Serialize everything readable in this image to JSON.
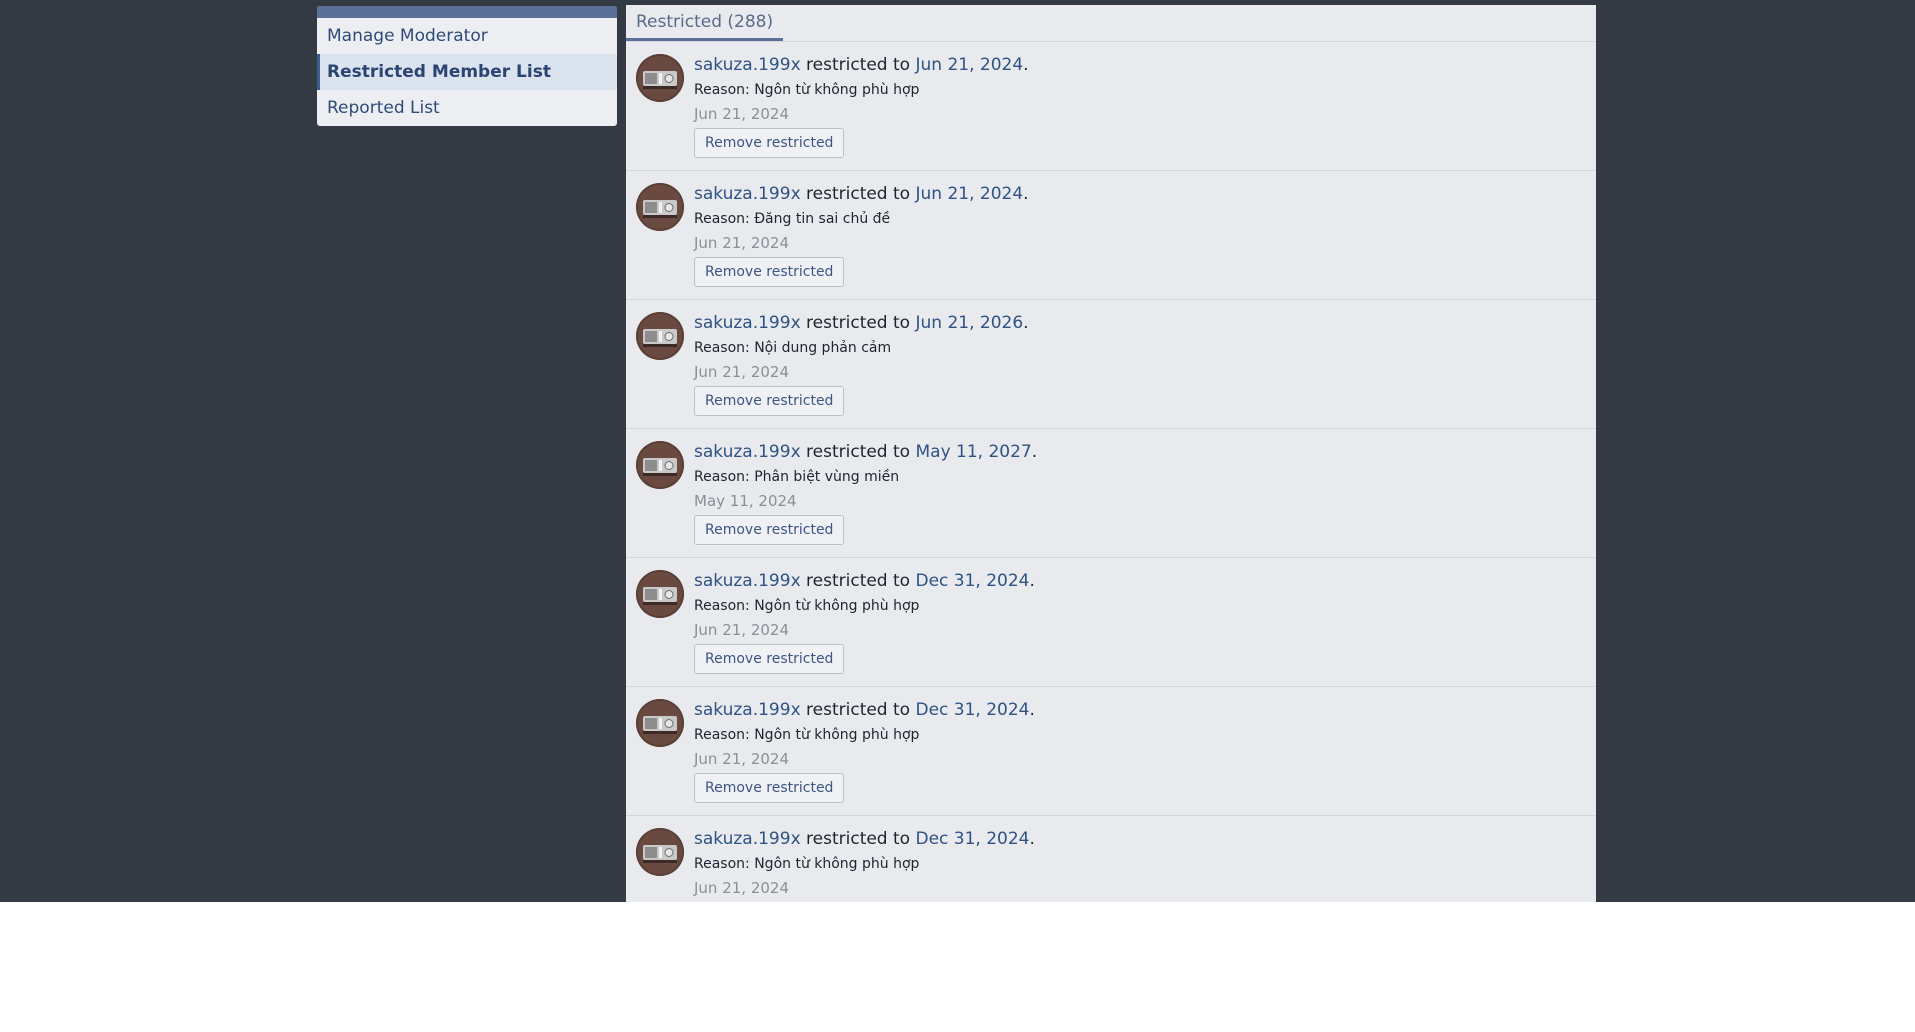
{
  "sidebar": {
    "items": [
      {
        "label": "Manage Moderator",
        "active": false
      },
      {
        "label": "Restricted Member List",
        "active": true
      },
      {
        "label": "Reported List",
        "active": false
      }
    ]
  },
  "main": {
    "tab_label": "Restricted (288)",
    "restricted_word": "restricted to",
    "reason_prefix": "Reason:",
    "button_label": "Remove restricted",
    "rows": [
      {
        "user": "sakuza.199x",
        "until": "Jun 21, 2024",
        "reason": "Ngôn từ không phù hợp",
        "date": "Jun 21, 2024"
      },
      {
        "user": "sakuza.199x",
        "until": "Jun 21, 2024",
        "reason": "Đăng tin sai chủ đề",
        "date": "Jun 21, 2024"
      },
      {
        "user": "sakuza.199x",
        "until": "Jun 21, 2026",
        "reason": "Nội dung phản cảm",
        "date": "Jun 21, 2024"
      },
      {
        "user": "sakuza.199x",
        "until": "May 11, 2027",
        "reason": "Phân biệt vùng miền",
        "date": "May 11, 2024"
      },
      {
        "user": "sakuza.199x",
        "until": "Dec 31, 2024",
        "reason": "Ngôn từ không phù hợp",
        "date": "Jun 21, 2024"
      },
      {
        "user": "sakuza.199x",
        "until": "Dec 31, 2024",
        "reason": "Ngôn từ không phù hợp",
        "date": "Jun 21, 2024"
      },
      {
        "user": "sakuza.199x",
        "until": "Dec 31, 2024",
        "reason": "Ngôn từ không phù hợp",
        "date": "Jun 21, 2024"
      }
    ]
  },
  "colors": {
    "background": "#343a44",
    "panel": "#e8eaed",
    "accent": "#5c6f99",
    "link": "#2f5285"
  }
}
